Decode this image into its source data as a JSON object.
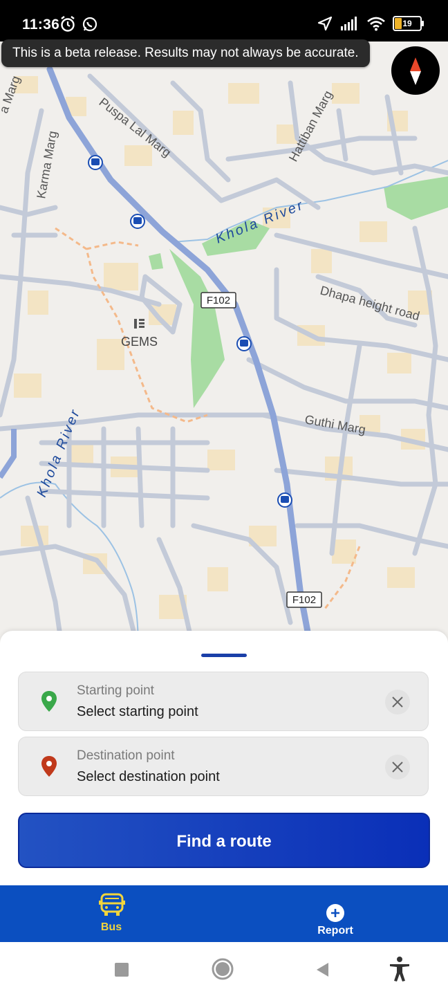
{
  "status_bar": {
    "time": "11:36",
    "battery": "19"
  },
  "banner": {
    "text": "This is a beta release. Results may not always be accurate."
  },
  "map": {
    "labels": {
      "karma": "Karma Marg",
      "puspa": "Puspa Lal Marg",
      "hattiban": "Hattiban Marg",
      "khola_top": "Khola River",
      "dhapa": "Dhapa height road",
      "gems": "GEMS",
      "guthi": "Guthi Marg",
      "khola_left": "Khola River",
      "edge": "a Marg",
      "f102_a": "F102",
      "f102_b": "F102"
    }
  },
  "form": {
    "start": {
      "label": "Starting point",
      "value": "Select starting point"
    },
    "destination": {
      "label": "Destination point",
      "value": "Select destination point"
    },
    "find_button": "Find a route"
  },
  "tabs": {
    "bus": "Bus",
    "report": "Report"
  },
  "colors": {
    "primary": "#0b4fc0",
    "accent": "#f2d53c",
    "start_pin": "#3aa84a",
    "dest_pin": "#c0391b"
  }
}
